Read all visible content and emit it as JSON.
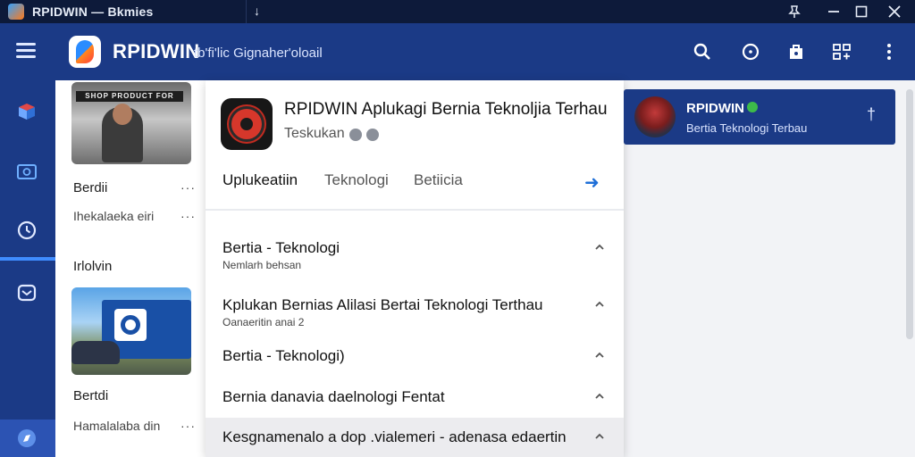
{
  "window": {
    "title": "RPIDWIN — Bkmies"
  },
  "header": {
    "brand": "RPIDWIN",
    "subtitle": "tb'fi'lic Gignaher'oloail"
  },
  "cards": [
    {
      "title": "Berdii",
      "subtitle": "Ihekalaeka eiri",
      "banner": "SHOP PRODUCT FOR"
    },
    {
      "title": "Irlolvin"
    },
    {
      "title": "Bertdi",
      "subtitle": "Hamalalaba din"
    }
  ],
  "panel": {
    "title": "RPIDWIN Aplukagi Bernia Teknoljia Terhau",
    "subtitle": "Teskukan",
    "tabs": [
      "Uplukeatiin",
      "Teknologi",
      "Betiicia"
    ],
    "items": [
      {
        "title": "Bertia - Teknologi",
        "subtitle": "Nemlarh behsan"
      },
      {
        "title": "Kplukan Bernias Alilasi Bertai Teknologi Terthau",
        "subtitle": "Oanaeritin anai 2"
      },
      {
        "title": "Bertia - Teknologi)"
      },
      {
        "title": "Bernia danavia daelnologi Fentat"
      },
      {
        "title": "Kesgnamenalo a dop .vialemeri - adenasa edaertin"
      }
    ]
  },
  "notification": {
    "title": "RPIDWIN",
    "subtitle": "Bertia Teknologi Terbau"
  },
  "colors": {
    "titlebar": "#0d1a3a",
    "header": "#1b3a86",
    "accent": "#3f8cff"
  }
}
